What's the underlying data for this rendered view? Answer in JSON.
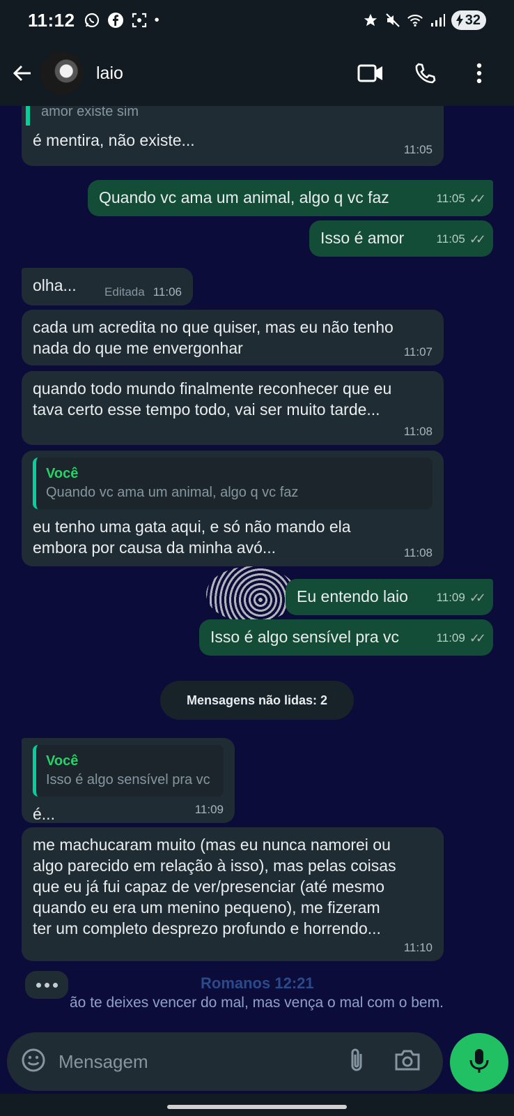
{
  "status_bar": {
    "time": "11:12",
    "battery": "32"
  },
  "header": {
    "contact_name": "laio"
  },
  "messages": {
    "m1": {
      "quote_tail": "amor existe sim",
      "text": "é mentira, não existe...",
      "time": "11:05"
    },
    "m2": {
      "text": "Quando vc ama um animal, algo q vc faz",
      "time": "11:05"
    },
    "m3": {
      "text": "Isso é amor",
      "time": "11:05"
    },
    "m4": {
      "text": "olha...",
      "edited": "Editada",
      "time": "11:06"
    },
    "m5": {
      "line1": "cada um acredita no que quiser, mas eu não tenho",
      "line2": "nada do que me envergonhar",
      "time": "11:07"
    },
    "m6": {
      "line1": "quando todo mundo finalmente reconhecer que eu",
      "line2": "tava certo esse tempo todo, vai ser muito tarde...",
      "time": "11:08"
    },
    "m7": {
      "quote_name": "Você",
      "quote_text": "Quando vc ama um animal, algo q vc faz",
      "line1": "eu tenho uma gata aqui, e só não mando ela",
      "line2": "embora por causa da minha avó...",
      "time": "11:08"
    },
    "m8": {
      "text": "Eu entendo laio",
      "time": "11:09"
    },
    "m9": {
      "text": "Isso é algo sensível pra vc",
      "time": "11:09"
    },
    "unread_label": "Mensagens não lidas: 2",
    "m10": {
      "quote_name": "Você",
      "quote_text": "Isso é algo sensível pra vc",
      "text": "é...",
      "time": "11:09"
    },
    "m11": {
      "line1": "me machucaram muito (mas eu nunca namorei ou",
      "line2": "algo parecido em relação à isso), mas pelas coisas",
      "line3": "que eu já fui capaz de ver/presenciar (até mesmo",
      "line4": "quando eu era um menino pequeno), me fizeram",
      "line5": "ter um completo desprezo profundo e horrendo...",
      "time": "11:10"
    }
  },
  "wallpaper": {
    "title": "Romanos 12:21",
    "verse": "ão te deixes vencer do mal, mas vença o mal com o bem."
  },
  "composer": {
    "placeholder": "Mensagem"
  },
  "icons": [
    "whatsapp-icon",
    "facebook-icon",
    "screenshot-icon",
    "star-icon",
    "mute-icon",
    "wifi-icon",
    "signal-icon",
    "back-arrow-icon",
    "video-call-icon",
    "phone-icon",
    "more-icon",
    "emoji-icon",
    "attach-icon",
    "camera-icon",
    "mic-icon"
  ],
  "colors": {
    "incoming_bubble": "#202c33",
    "outgoing_bubble": "#144d37",
    "accent": "#21c063",
    "background": "#0c0c3a"
  }
}
